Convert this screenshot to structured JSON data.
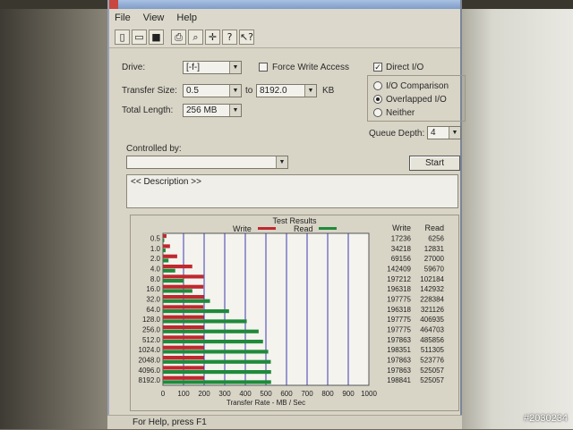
{
  "window": {
    "menu": [
      "File",
      "View",
      "Help"
    ],
    "toolbar_icons": [
      "new-icon",
      "open-icon",
      "save-icon",
      "print-icon",
      "print-preview-icon",
      "crosshair-icon",
      "help-icon",
      "whats-this-icon"
    ]
  },
  "form": {
    "drive_label": "Drive:",
    "drive_value": "[-f-]",
    "force_write_label": "Force Write Access",
    "force_write_checked": false,
    "direct_io_label": "Direct I/O",
    "direct_io_checked": true,
    "transfer_size_label": "Transfer Size:",
    "transfer_from": "0.5",
    "to_label": "to",
    "transfer_to": "8192.0",
    "kb_label": "KB",
    "total_length_label": "Total Length:",
    "total_length_value": "256 MB",
    "io_mode_options": [
      "I/O Comparison",
      "Overlapped I/O",
      "Neither"
    ],
    "io_mode_selected": 1,
    "queue_depth_label": "Queue Depth:",
    "queue_depth_value": "4",
    "controlled_by_label": "Controlled by:",
    "controlled_by_value": "",
    "start_label": "Start",
    "description": "<< Description >>"
  },
  "chart_data": {
    "type": "bar",
    "title": "Test Results",
    "xlabel": "Transfer Rate - MB / Sec",
    "ylabel": "",
    "xlim": [
      0,
      1000
    ],
    "x_ticks": [
      "0",
      "100",
      "200",
      "300",
      "400",
      "500",
      "600",
      "700",
      "800",
      "900",
      "1000"
    ],
    "categories": [
      "0.5",
      "1.0",
      "2.0",
      "4.0",
      "8.0",
      "16.0",
      "32.0",
      "64.0",
      "128.0",
      "256.0",
      "512.0",
      "1024.0",
      "2048.0",
      "4096.0",
      "8192.0"
    ],
    "series": [
      {
        "name": "Write",
        "color": "#c0282d",
        "values": [
          17.2,
          34.2,
          69.2,
          142.4,
          197.2,
          196.3,
          197.8,
          196.3,
          197.8,
          197.8,
          197.9,
          198.4,
          197.9,
          197.9,
          198.8
        ]
      },
      {
        "name": "Read",
        "color": "#1f8a3a",
        "values": [
          6.3,
          12.8,
          27.0,
          59.7,
          102.2,
          142.9,
          228.4,
          321.1,
          406.9,
          464.7,
          485.9,
          511.3,
          523.8,
          525.1,
          525.1
        ]
      }
    ],
    "table_headers": [
      "Write",
      "Read"
    ],
    "table_rows": [
      [
        "17236",
        "6256"
      ],
      [
        "34218",
        "12831"
      ],
      [
        "69156",
        "27000"
      ],
      [
        "142409",
        "59670"
      ],
      [
        "197212",
        "102184"
      ],
      [
        "196318",
        "142932"
      ],
      [
        "197775",
        "228384"
      ],
      [
        "196318",
        "321126"
      ],
      [
        "197775",
        "406935"
      ],
      [
        "197775",
        "464703"
      ],
      [
        "197863",
        "485856"
      ],
      [
        "198351",
        "511305"
      ],
      [
        "197863",
        "523776"
      ],
      [
        "197863",
        "525057"
      ],
      [
        "198841",
        "525057"
      ]
    ],
    "grid": true,
    "legend": "top"
  },
  "status": "For Help, press F1",
  "watermark": "#2030234"
}
